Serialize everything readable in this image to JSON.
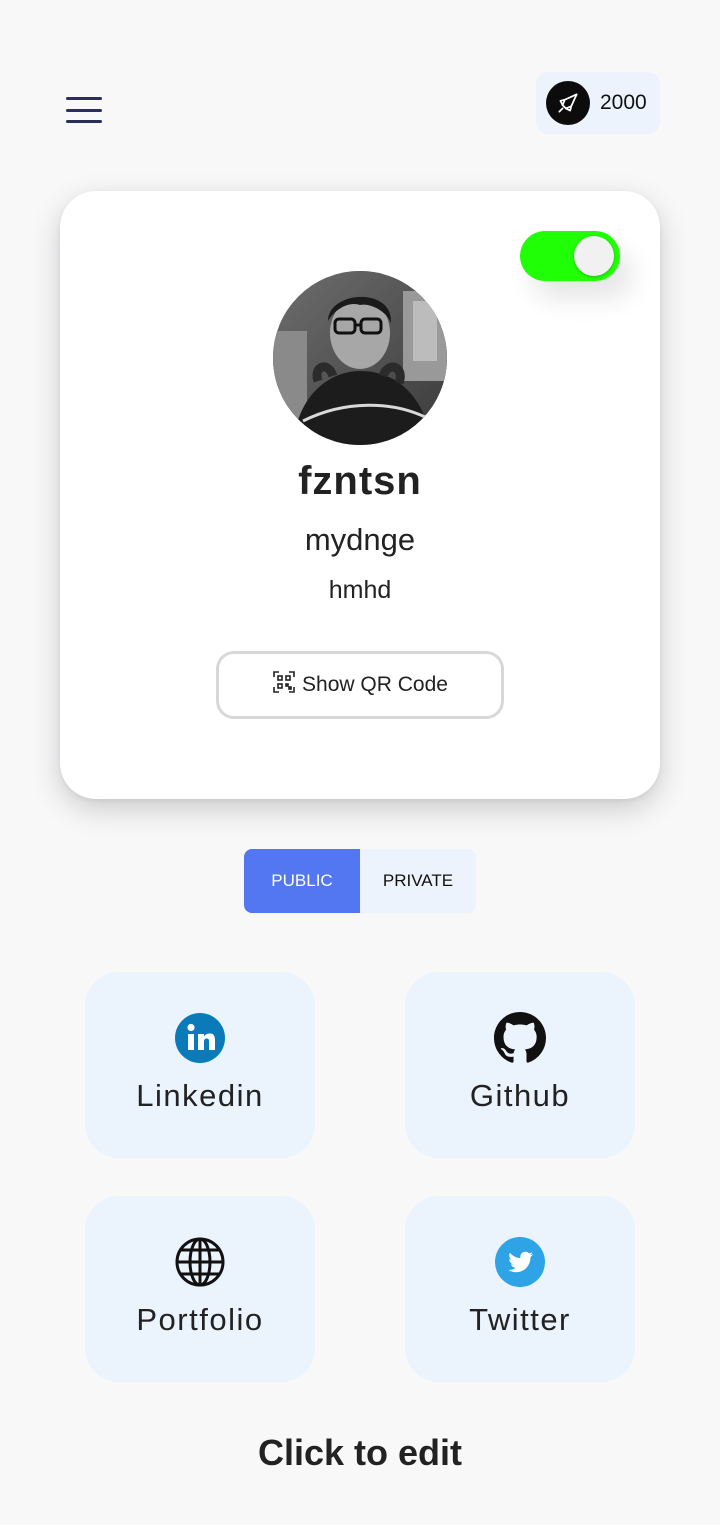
{
  "header": {
    "points_value": "2000",
    "menu_icon": "hamburger-menu-icon",
    "points_icon": "rocket-icon"
  },
  "profile": {
    "name": "fzntsn",
    "subtitle": "mydnge",
    "detail": "hmhd",
    "toggle_on": true,
    "qr_button_label": "Show QR Code",
    "toggle_color": "#21ff06"
  },
  "visibility": {
    "public_label": "PUBLIC",
    "private_label": "PRIVATE",
    "selected": "PUBLIC",
    "accent": "#5277f0"
  },
  "links": [
    {
      "label": "Linkedin",
      "icon": "linkedin-icon",
      "color": "#0a7bb8"
    },
    {
      "label": "Github",
      "icon": "github-icon",
      "color": "#111111"
    },
    {
      "label": "Portfolio",
      "icon": "globe-icon",
      "color": "#111111"
    },
    {
      "label": "Twitter",
      "icon": "twitter-icon",
      "color": "#2ea3e6"
    }
  ],
  "footer": {
    "edit_label": "Click to edit"
  }
}
